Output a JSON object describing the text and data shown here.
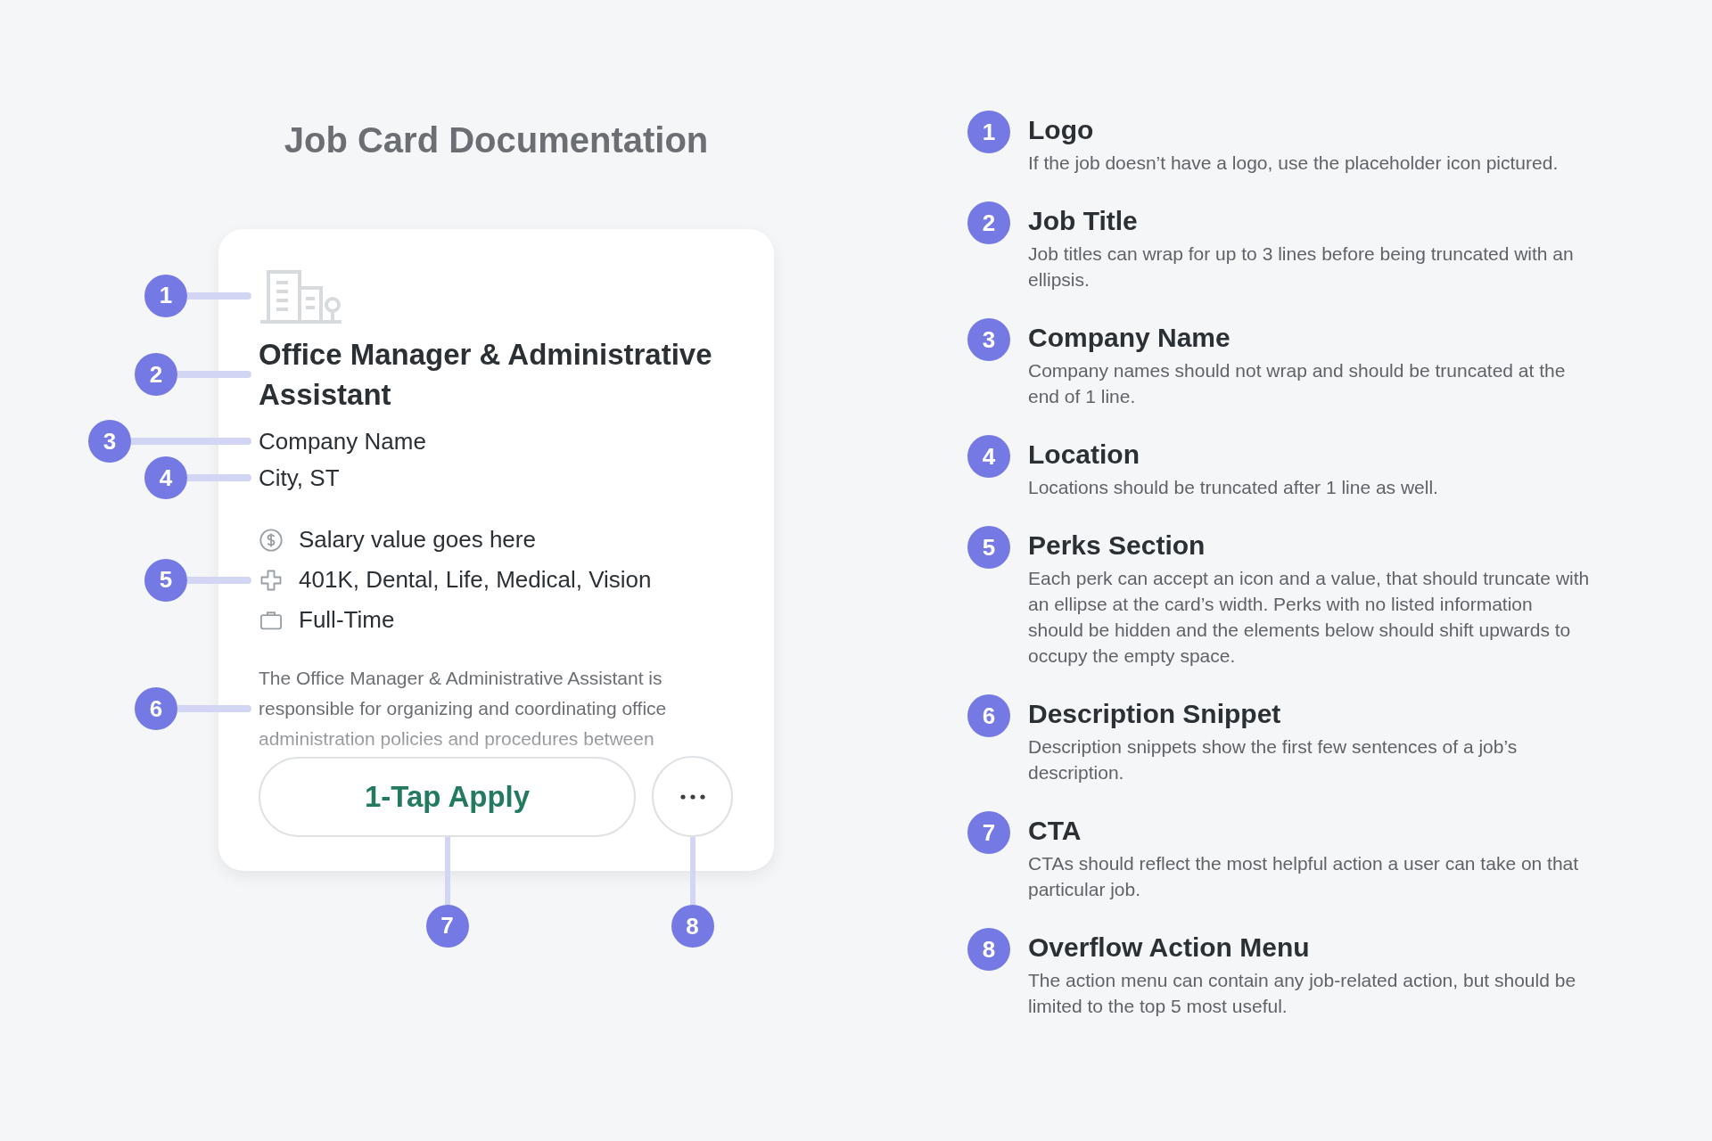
{
  "title": "Job Card Documentation",
  "card": {
    "job_title": "Office Manager & Administrative Assistant",
    "company": "Company Name",
    "location": "City, ST",
    "perks": [
      {
        "kind": "salary",
        "text": "Salary value goes here"
      },
      {
        "kind": "benefits",
        "text": "401K, Dental, Life, Medical, Vision"
      },
      {
        "kind": "job_type",
        "text": "Full-Time"
      }
    ],
    "description": "The Office Manager & Administrative Assistant is responsible for organizing and coordinating office administration policies and procedures between",
    "primary_action": "1-Tap Apply"
  },
  "markers": [
    {
      "number": "1",
      "kind": "logo"
    },
    {
      "number": "2",
      "kind": "job_title"
    },
    {
      "number": "3",
      "kind": "company"
    },
    {
      "number": "4",
      "kind": "location"
    },
    {
      "number": "5",
      "kind": "perks"
    },
    {
      "number": "6",
      "kind": "description"
    },
    {
      "number": "7",
      "kind": "primary_action"
    },
    {
      "number": "8",
      "kind": "overflow"
    }
  ],
  "notes": [
    {
      "number": "1",
      "heading": "Logo",
      "text": "If the job doesn’t have a logo, use the placeholder icon pictured."
    },
    {
      "number": "2",
      "heading": "Job Title",
      "text": "Job titles can wrap for up to 3 lines before being truncated with an ellipsis."
    },
    {
      "number": "3",
      "heading": "Company Name",
      "text": "Company names should not wrap and should be truncated at the end of 1 line."
    },
    {
      "number": "4",
      "heading": "Location",
      "text": "Locations should be truncated after 1 line as well."
    },
    {
      "number": "5",
      "heading": "Perks Section",
      "text": "Each perk can accept an icon and a value, that should truncate with an ellipse at the card’s width. Perks with no listed information should be hidden and the elements below should shift upwards to occupy the empty space."
    },
    {
      "number": "6",
      "heading": "Description Snippet",
      "text": "Description snippets show the first few sentences of a job’s description."
    },
    {
      "number": "7",
      "heading": "CTA",
      "text": "CTAs should reflect the most helpful action a user can take on that particular job."
    },
    {
      "number": "8",
      "heading": "Overflow Action Menu",
      "text": "The action menu can contain any job-related action, but should be limited to the top 5 most useful."
    }
  ]
}
